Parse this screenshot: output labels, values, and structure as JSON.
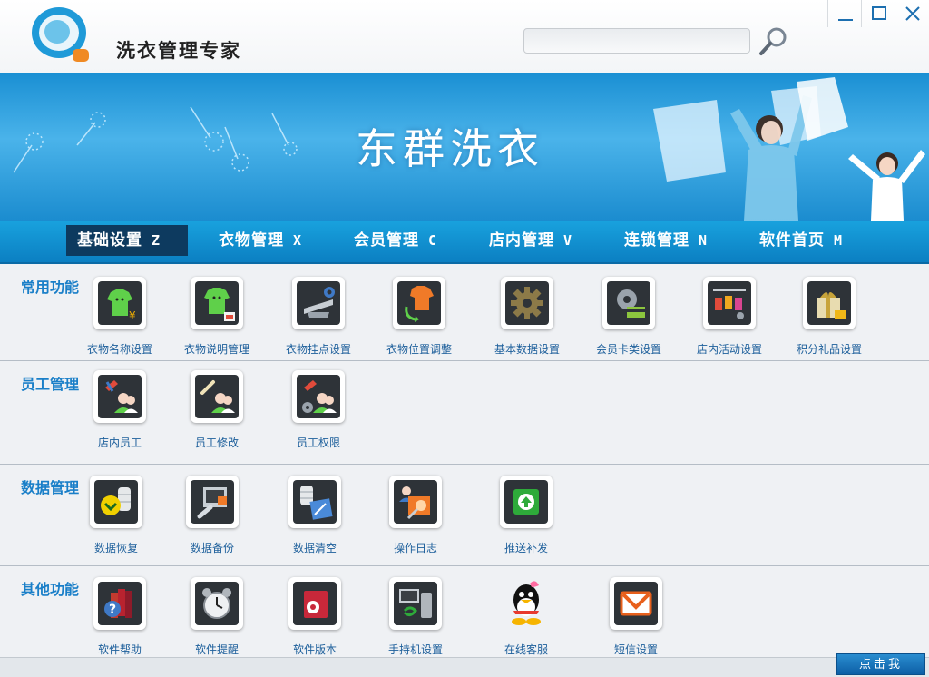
{
  "app": {
    "title": "洗衣管理专家",
    "search_placeholder": ""
  },
  "banner": {
    "title": "东群洗衣"
  },
  "nav": {
    "tabs": [
      {
        "label": "基础设置",
        "key": "Z",
        "active": true
      },
      {
        "label": "衣物管理",
        "key": "X",
        "active": false
      },
      {
        "label": "会员管理",
        "key": "C",
        "active": false
      },
      {
        "label": "店内管理",
        "key": "V",
        "active": false
      },
      {
        "label": "连锁管理",
        "key": "N",
        "active": false
      },
      {
        "label": "软件首页",
        "key": "M",
        "active": false
      }
    ]
  },
  "sections": [
    {
      "title": "常用功能",
      "items": [
        {
          "label": "衣物名称设置",
          "icon": "shirt-icon"
        },
        {
          "label": "衣物说明管理",
          "icon": "shirt-note-icon"
        },
        {
          "label": "衣物挂点设置",
          "icon": "hanger-gear-icon"
        },
        {
          "label": "衣物位置调整",
          "icon": "shirt-move-icon"
        },
        {
          "label": "基本数据设置",
          "icon": "gear-icon"
        },
        {
          "label": "会员卡类设置",
          "icon": "card-gear-icon"
        },
        {
          "label": "店内活动设置",
          "icon": "tags-icon"
        },
        {
          "label": "积分礼品设置",
          "icon": "gift-icon"
        }
      ]
    },
    {
      "title": "员工管理",
      "items": [
        {
          "label": "店内员工",
          "icon": "staff-icon"
        },
        {
          "label": "员工修改",
          "icon": "staff-edit-icon"
        },
        {
          "label": "员工权限",
          "icon": "staff-permission-icon"
        }
      ]
    },
    {
      "title": "数据管理",
      "items": [
        {
          "label": "数据恢复",
          "icon": "database-restore-icon"
        },
        {
          "label": "数据备份",
          "icon": "database-backup-icon"
        },
        {
          "label": "数据清空",
          "icon": "database-clear-icon"
        },
        {
          "label": "操作日志",
          "icon": "log-search-icon"
        },
        {
          "label": "推送补发",
          "icon": "push-up-icon"
        }
      ]
    },
    {
      "title": "其他功能",
      "items": [
        {
          "label": "软件帮助",
          "icon": "help-book-icon"
        },
        {
          "label": "软件提醒",
          "icon": "alarm-clock-icon"
        },
        {
          "label": "软件版本",
          "icon": "version-icon"
        },
        {
          "label": "手持机设置",
          "icon": "handheld-icon"
        },
        {
          "label": "在线客服",
          "icon": "qq-penguin-icon"
        },
        {
          "label": "短信设置",
          "icon": "mail-icon"
        }
      ]
    }
  ],
  "footer": {
    "button_label": "点击我"
  },
  "colors": {
    "nav_bg": "#0b7fc2",
    "nav_active": "#0d3a5f",
    "section_title": "#1a7fc8",
    "label": "#1d5f9b",
    "banner": "#2aa0e0"
  }
}
